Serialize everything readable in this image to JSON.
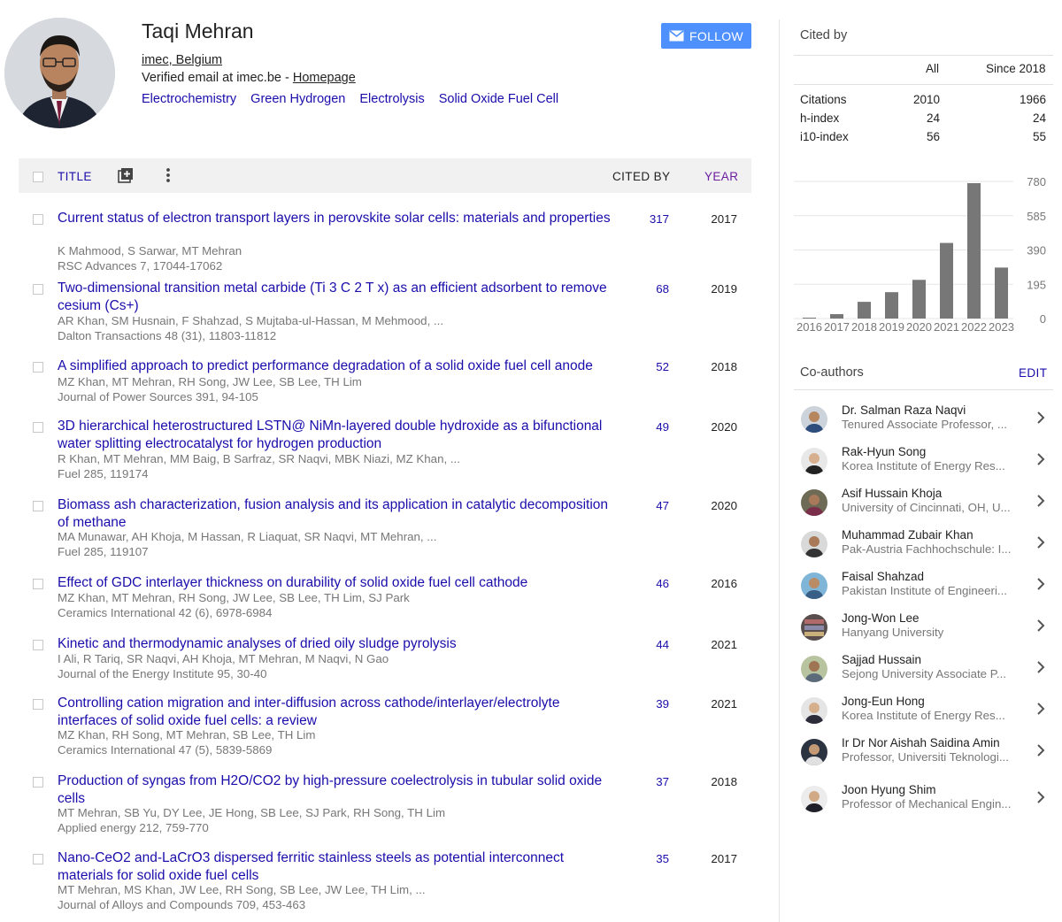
{
  "profile": {
    "name": "Taqi Mehran",
    "affiliation": "imec, Belgium",
    "email_text": "Verified email at imec.be - ",
    "homepage_label": "Homepage",
    "interests": [
      "Electrochemistry",
      "Green Hydrogen",
      "Electrolysis",
      "Solid Oxide Fuel Cell"
    ],
    "follow_label": "FOLLOW"
  },
  "table": {
    "title_header": "TITLE",
    "cited_header": "CITED BY",
    "year_header": "YEAR"
  },
  "publications": [
    {
      "title": "Current status of electron transport layers in perovskite solar cells: materials and properties",
      "authors": "K Mahmood, S Sarwar, MT Mehran",
      "venue": "RSC Advances 7, 17044-17062",
      "cited": "317",
      "year": "2017"
    },
    {
      "title": "Two-dimensional transition metal carbide (Ti 3 C 2 T x) as an efficient adsorbent to remove cesium (Cs+)",
      "authors": "AR Khan, SM Husnain, F Shahzad, S Mujtaba-ul-Hassan, M Mehmood, ...",
      "venue": "Dalton Transactions 48 (31), 11803-11812",
      "cited": "68",
      "year": "2019"
    },
    {
      "title": "A simplified approach to predict performance degradation of a solid oxide fuel cell anode",
      "authors": "MZ Khan, MT Mehran, RH Song, JW Lee, SB Lee, TH Lim",
      "venue": "Journal of Power Sources 391, 94-105",
      "cited": "52",
      "year": "2018"
    },
    {
      "title": "3D hierarchical heterostructured LSTN@ NiMn-layered double hydroxide as a bifunctional water splitting electrocatalyst for hydrogen production",
      "authors": "R Khan, MT Mehran, MM Baig, B Sarfraz, SR Naqvi, MBK Niazi, MZ Khan, ...",
      "venue": "Fuel 285, 119174",
      "cited": "49",
      "year": "2020"
    },
    {
      "title": "Biomass ash characterization, fusion analysis and its application in catalytic decomposition of methane",
      "authors": "MA Munawar, AH Khoja, M Hassan, R Liaquat, SR Naqvi, MT Mehran, ...",
      "venue": "Fuel 285, 119107",
      "cited": "47",
      "year": "2020"
    },
    {
      "title": "Effect of GDC interlayer thickness on durability of solid oxide fuel cell cathode",
      "authors": "MZ Khan, MT Mehran, RH Song, JW Lee, SB Lee, TH Lim, SJ Park",
      "venue": "Ceramics International 42 (6), 6978-6984",
      "cited": "46",
      "year": "2016"
    },
    {
      "title": "Kinetic and thermodynamic analyses of dried oily sludge pyrolysis",
      "authors": "I Ali, R Tariq, SR Naqvi, AH Khoja, MT Mehran, M Naqvi, N Gao",
      "venue": "Journal of the Energy Institute 95, 30-40",
      "cited": "44",
      "year": "2021"
    },
    {
      "title": "Controlling cation migration and inter-diffusion across cathode/interlayer/electrolyte interfaces of solid oxide fuel cells: a review",
      "authors": "MZ Khan, RH Song, MT Mehran, SB Lee, TH Lim",
      "venue": "Ceramics International 47 (5), 5839-5869",
      "cited": "39",
      "year": "2021"
    },
    {
      "title": "Production of syngas from H2O/CO2 by high-pressure coelectrolysis in tubular solid oxide cells",
      "authors": "MT Mehran, SB Yu, DY Lee, JE Hong, SB Lee, SJ Park, RH Song, TH Lim",
      "venue": "Applied energy 212, 759-770",
      "cited": "37",
      "year": "2018"
    },
    {
      "title": "Nano-CeO2 and-LaCrO3 dispersed ferritic stainless steels as potential interconnect materials for solid oxide fuel cells",
      "authors": "MT Mehran, MS Khan, JW Lee, RH Song, SB Lee, JW Lee, TH Lim, ...",
      "venue": "Journal of Alloys and Compounds 709, 453-463",
      "cited": "35",
      "year": "2017"
    }
  ],
  "cited_by": {
    "title": "Cited by",
    "col_all": "All",
    "col_since": "Since 2018",
    "rows": [
      {
        "label": "Citations",
        "all": "2010",
        "since": "1966"
      },
      {
        "label": "h-index",
        "all": "24",
        "since": "24"
      },
      {
        "label": "i10-index",
        "all": "56",
        "since": "55"
      }
    ]
  },
  "chart_data": {
    "type": "bar",
    "categories": [
      "2016",
      "2017",
      "2018",
      "2019",
      "2020",
      "2021",
      "2022",
      "2023"
    ],
    "values": [
      5,
      25,
      95,
      150,
      220,
      430,
      770,
      290
    ],
    "ylim": [
      0,
      780
    ],
    "yticks": [
      "780",
      "585",
      "390",
      "195",
      "0"
    ],
    "bar_color": "#777777"
  },
  "coauthors": {
    "title": "Co-authors",
    "edit_label": "EDIT",
    "items": [
      {
        "name": "Dr. Salman Raza Naqvi",
        "affiliation": "Tenured Associate Professor, ..."
      },
      {
        "name": "Rak-Hyun Song",
        "affiliation": "Korea Institute of Energy Res..."
      },
      {
        "name": "Asif Hussain Khoja",
        "affiliation": "University of Cincinnati, OH, U..."
      },
      {
        "name": "Muhammad Zubair Khan",
        "affiliation": "Pak-Austria Fachhochschule: I..."
      },
      {
        "name": "Faisal Shahzad",
        "affiliation": "Pakistan Institute of Engineeri..."
      },
      {
        "name": "Jong-Won Lee",
        "affiliation": "Hanyang University"
      },
      {
        "name": "Sajjad Hussain",
        "affiliation": "Sejong University Associate P..."
      },
      {
        "name": "Jong-Eun Hong",
        "affiliation": "Korea Institute of Energy Res..."
      },
      {
        "name": "Ir Dr Nor Aishah Saidina Amin",
        "affiliation": "Professor, Universiti Teknologi..."
      },
      {
        "name": "Joon Hyung Shim",
        "affiliation": "Professor of Mechanical Engin..."
      }
    ]
  }
}
